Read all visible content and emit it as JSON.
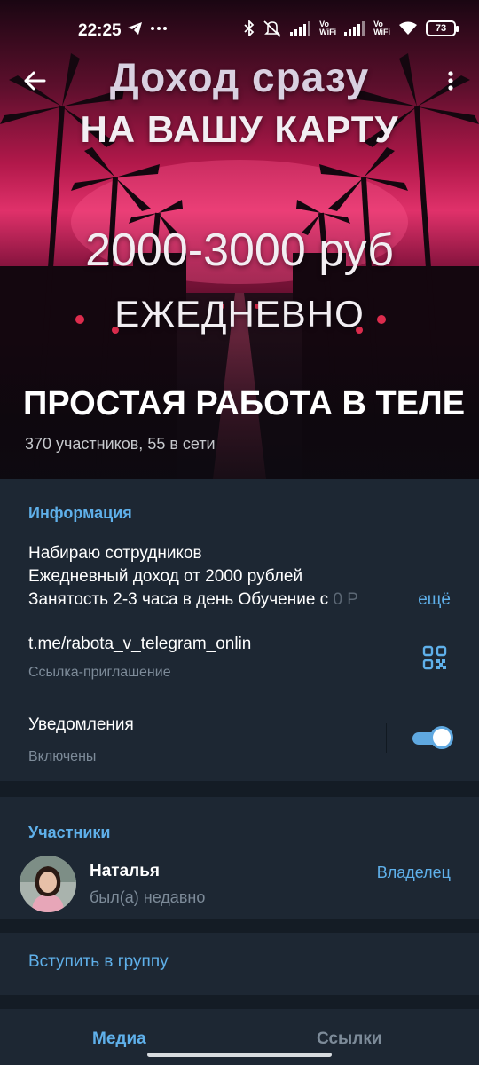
{
  "status_bar": {
    "time": "22:25",
    "vowifi_1": "Vo\nWiFi",
    "vowifi_2": "Vo\nWiFi",
    "battery": "73",
    "icons": [
      "telegram-icon",
      "more-dots-icon",
      "bluetooth-icon",
      "mute-icon",
      "signal-icon",
      "wifi-icon",
      "battery-icon"
    ]
  },
  "header": {
    "back_icon": "arrow-left-icon",
    "menu_icon": "more-vertical-icon"
  },
  "poster": {
    "line1": "Доход сразу",
    "line2": "НА ВАШУ КАРТУ",
    "line3": "2000-3000 руб",
    "line4": "ЕЖЕДНЕВНО"
  },
  "group": {
    "title": "ПРОСТАЯ РАБОТА В ТЕЛЕ",
    "subtitle": "370 участников, 55 в сети"
  },
  "info": {
    "section_title": "Информация",
    "description_line1": "Набираю сотрудников",
    "description_line2": "Ежедневный доход от 2000 рублей",
    "description_line3": "Занятость 2-3 часа в день Обучение с ",
    "description_fade": "0 Р",
    "more_label": "ещё",
    "link": "t.me/rabota_v_telegram_onlin",
    "link_caption": "Ссылка-приглашение",
    "qr_icon": "qr-code-icon",
    "notifications_label": "Уведомления",
    "notifications_status": "Включены",
    "notifications_enabled": true
  },
  "members": {
    "section_title": "Участники",
    "items": [
      {
        "name": "Наталья",
        "status": "был(а) недавно",
        "role": "Владелец"
      }
    ]
  },
  "join": {
    "label": "Вступить в группу"
  },
  "tabs": [
    {
      "label": "Медиа",
      "active": true
    },
    {
      "label": "Ссылки",
      "active": false
    }
  ],
  "colors": {
    "accent": "#5fb0ea",
    "background": "#1d2733",
    "separator": "#141c25",
    "muted_text": "#7d8b99"
  }
}
